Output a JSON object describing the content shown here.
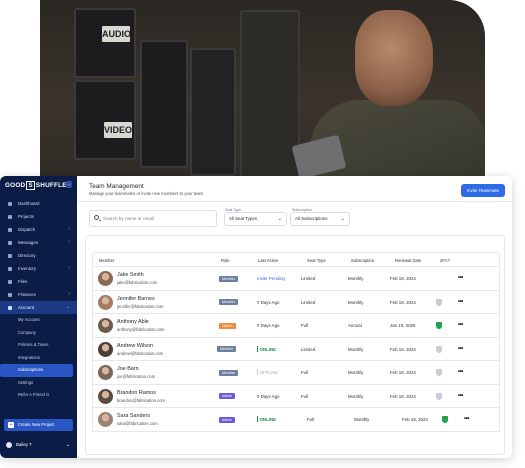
{
  "brand": {
    "logo_left": "GOOD",
    "logo_box": "S",
    "logo_right": "SHUFFLE"
  },
  "sidebar": {
    "items": [
      {
        "label": "Dashboard",
        "chevron": ""
      },
      {
        "label": "Projects",
        "chevron": ""
      },
      {
        "label": "Dispatch",
        "chevron": "›"
      },
      {
        "label": "Messages",
        "chevron": "›"
      },
      {
        "label": "Directory",
        "chevron": ""
      },
      {
        "label": "Inventory",
        "chevron": "›"
      },
      {
        "label": "Files",
        "chevron": ""
      },
      {
        "label": "Finances",
        "chevron": "›"
      },
      {
        "label": "Account",
        "chevron": "⌄"
      }
    ],
    "sub_items": [
      {
        "label": "My Account"
      },
      {
        "label": "Company"
      },
      {
        "label": "Policies & Taxes"
      },
      {
        "label": "Integrations"
      },
      {
        "label": "Subscriptions"
      },
      {
        "label": "Settings"
      },
      {
        "label": "Refer A Friend"
      }
    ],
    "refer_badge": "⊡",
    "create_label": "Create New Project",
    "user_name": "Bailey T"
  },
  "header": {
    "title": "Team Management",
    "subtitle": "Manage your teammates or invite new members to your team",
    "invite_label": "Invite Teammate"
  },
  "filters": {
    "search_placeholder": "Search by name or email",
    "seat_type_label": "Seat Type",
    "seat_type_value": "All Seat Types",
    "subscription_label": "Subscription",
    "subscription_value": "All Subscriptions"
  },
  "table": {
    "headers": [
      "Member",
      "Role",
      "Last Active",
      "Seat Type",
      "Subscription",
      "Renewal Date",
      "2FA?"
    ],
    "rows": [
      {
        "name": "Jake Smith",
        "email": "jake@fabrication.com",
        "role": "Member",
        "last_active": "Invite Pending",
        "status": "pending",
        "seat": "Limited",
        "subscription": "Monthly",
        "renewal": "Feb 19, 2024",
        "twofa": "none",
        "actions": "•••"
      },
      {
        "name": "Jennifer Barnes",
        "email": "jennifer@fabrication.com",
        "role": "Member",
        "last_active": "# Days Ago",
        "status": "text",
        "seat": "Limited",
        "subscription": "Monthly",
        "renewal": "Feb 19, 2024",
        "twofa": "off",
        "actions": "•••"
      },
      {
        "name": "Anthony Able",
        "email": "anthony@fabrication.com",
        "role": "Owner",
        "last_active": "# Days Ago",
        "status": "text",
        "seat": "Full",
        "subscription": "Annual",
        "renewal": "Jan 19, 2025",
        "twofa": "on",
        "actions": "•••"
      },
      {
        "name": "Andrew Wilson",
        "email": "andrew@fabrication.com",
        "role": "Member",
        "last_active": "ONLINE",
        "status": "online",
        "seat": "Limited",
        "subscription": "Monthly",
        "renewal": "Feb 19, 2024",
        "twofa": "off",
        "actions": "•••"
      },
      {
        "name": "Joe Barn",
        "email": "joe@fabrication.com",
        "role": "Member",
        "last_active": "OFFLINE",
        "status": "offline",
        "seat": "Full",
        "subscription": "Monthly",
        "renewal": "Feb 19, 2024",
        "twofa": "off",
        "actions": "•••"
      },
      {
        "name": "Brandon Ramos",
        "email": "brandon@fabrication.com",
        "role": "Admin",
        "last_active": "# Days Ago",
        "status": "text",
        "seat": "Full",
        "subscription": "Monthly",
        "renewal": "Feb 19, 2024",
        "twofa": "off",
        "actions": "•••"
      },
      {
        "name": "Sara Sanders",
        "email": "sara@fabrication.com",
        "role": "Admin",
        "last_active": "ONLINE",
        "status": "online",
        "seat": "Full",
        "subscription": "Monthly",
        "renewal": "Feb 19, 2024",
        "twofa": "on",
        "actions": "•••"
      }
    ]
  },
  "colors": {
    "sidebar_bg": "#0b1d47",
    "accent": "#2f6be6",
    "member_badge": "#6d7f9c",
    "owner_badge": "#f08a3c",
    "admin_badge": "#6b5ae0",
    "online": "#179447",
    "twofa_on": "#22a04f",
    "twofa_off": "#c7ccd6"
  },
  "photo_labels": {
    "case_audio": "AUDIO",
    "case_video": "VIDEO"
  }
}
